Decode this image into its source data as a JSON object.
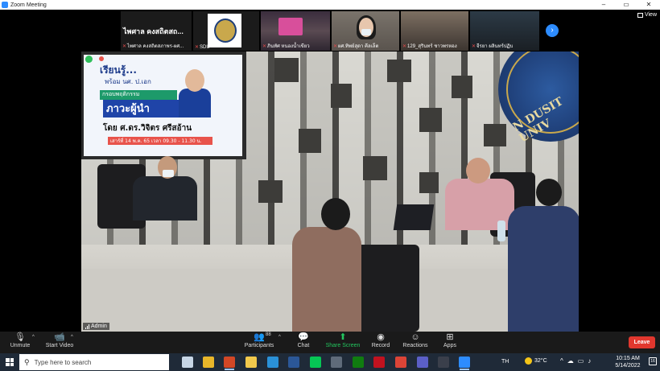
{
  "window": {
    "title": "Zoom Meeting",
    "controls": [
      "–",
      "▭",
      "✕"
    ]
  },
  "strip": {
    "tiles": [
      {
        "big_name": "ไพศาล คงสถิตสถ...",
        "name": "ไพศาล คงสถิตสภาพร-ผศ..."
      },
      {
        "name": "SDU"
      },
      {
        "name": "ภินทัศ หนองน้ำเขียว"
      },
      {
        "name": "ผศ.ทิพย์สุดา คีลเล็ต"
      },
      {
        "name": "129_สุรินทร์ ชาวพรหอง"
      },
      {
        "name": "จีรยา ผลินทร์ปฏิบ"
      }
    ],
    "view_label": "View"
  },
  "main_video": {
    "participant_label": "Admin",
    "slide": {
      "title": "เรียนรู้...",
      "subtitle": "พร้อม นศ. ป.เอก",
      "band": "กรอบพฤติกรรม",
      "big": "ภาวะผู้นำ",
      "by": "โดย ศ.ดร.วิจิตร ศรีสอ้าน",
      "date": "เสาร์ที่ 14 พ.ค. 65  เวลา 09.30 - 11.30 น."
    },
    "wall_logo_text": "N DUSIT UNIV"
  },
  "controls": {
    "unmute": "Unmute",
    "start_video": "Start Video",
    "participants": "Participants",
    "participants_count": "88",
    "chat": "Chat",
    "share_screen": "Share Screen",
    "record": "Record",
    "reactions": "Reactions",
    "apps": "Apps",
    "leave": "Leave"
  },
  "taskbar": {
    "search_placeholder": "Type here to search",
    "language": "TH",
    "temperature": "32°C",
    "time": "10:15 AM",
    "date": "5/14/2022",
    "notification_count": "16",
    "apps": [
      {
        "name": "task-view-icon",
        "color": "#c7d6e6"
      },
      {
        "name": "chrome-icon",
        "color": "#e8b62a"
      },
      {
        "name": "powerpoint-icon",
        "color": "#d24726"
      },
      {
        "name": "file-explorer-icon",
        "color": "#f1c94c"
      },
      {
        "name": "edge-icon",
        "color": "#2a91d8"
      },
      {
        "name": "word-icon",
        "color": "#2b5797"
      },
      {
        "name": "line-icon",
        "color": "#06c755"
      },
      {
        "name": "calculator-icon",
        "color": "#5f6b7a"
      },
      {
        "name": "xbox-icon",
        "color": "#107c10"
      },
      {
        "name": "app-red-icon",
        "color": "#c1121f"
      },
      {
        "name": "chrome-alt-icon",
        "color": "#db4437"
      },
      {
        "name": "teams-icon",
        "color": "#5b5fc7"
      },
      {
        "name": "app-dark-icon",
        "color": "#3a3f4b"
      },
      {
        "name": "zoom-icon",
        "color": "#2d8cff"
      }
    ]
  },
  "colors": {
    "zoom_blue": "#2d8cff",
    "share_green": "#23c55e",
    "leave_red": "#e0372e",
    "taskbar": "#1f2a38"
  }
}
